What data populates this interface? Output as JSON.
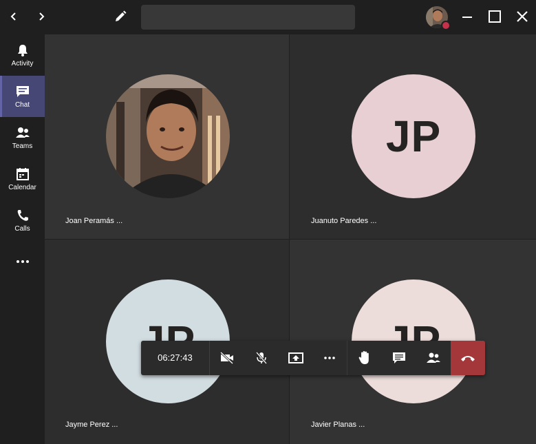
{
  "window": {
    "search_placeholder": "",
    "presence_color": "#c4314b"
  },
  "rail": {
    "items": [
      {
        "label": "Activity",
        "icon": "bell-icon"
      },
      {
        "label": "Chat",
        "icon": "chat-icon",
        "active": true
      },
      {
        "label": "Teams",
        "icon": "teams-icon"
      },
      {
        "label": "Calendar",
        "icon": "calendar-icon"
      },
      {
        "label": "Calls",
        "icon": "phone-icon"
      },
      {
        "label": "",
        "icon": "more-icon"
      }
    ],
    "accent": "#6264a7"
  },
  "participants": [
    {
      "name": "Joan Peramás ...",
      "initials": "",
      "has_photo": true
    },
    {
      "name": "Juanuto Paredes ...",
      "initials": "JP",
      "color": "#e8cfd3"
    },
    {
      "name": "Jayme Perez ...",
      "initials": "JP",
      "color": "#d2dde1"
    },
    {
      "name": "Javier Planas ...",
      "initials": "JP",
      "color": "#ecdcda"
    }
  ],
  "callbar": {
    "timer": "06:27:43",
    "buttons": [
      "video-off-icon",
      "mic-off-icon",
      "share-screen-icon",
      "more-icon",
      "raise-hand-icon",
      "chat-bubble-icon",
      "participants-icon",
      "hang-up-icon"
    ],
    "hangup_color": "#a4373a"
  }
}
